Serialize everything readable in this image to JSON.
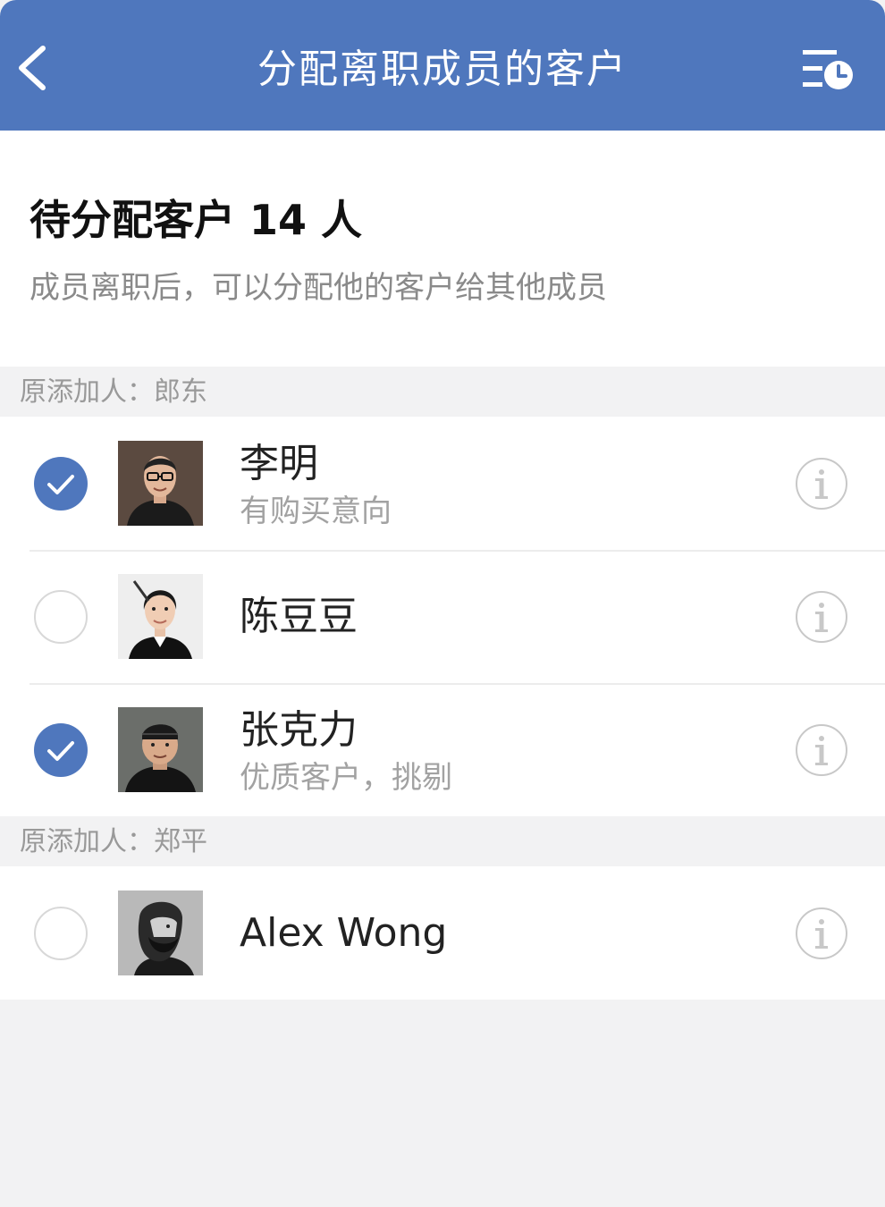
{
  "navbar": {
    "title": "分配离职成员的客户",
    "back_icon": "chevron-left-icon",
    "history_icon": "list-clock-icon",
    "bg_color": "#4f77bd"
  },
  "summary": {
    "title": "待分配客户 14 人",
    "subtitle": "成员离职后，可以分配他的客户给其他成员"
  },
  "groups": [
    {
      "header": "原添加人：郎东",
      "customers": [
        {
          "name": "李明",
          "note": "有购买意向",
          "checked": true
        },
        {
          "name": "陈豆豆",
          "note": "",
          "checked": false
        },
        {
          "name": "张克力",
          "note": "优质客户，挑剔",
          "checked": true
        }
      ]
    },
    {
      "header": "原添加人：郑平",
      "customers": [
        {
          "name": "Alex Wong",
          "note": "",
          "checked": false
        }
      ]
    }
  ]
}
